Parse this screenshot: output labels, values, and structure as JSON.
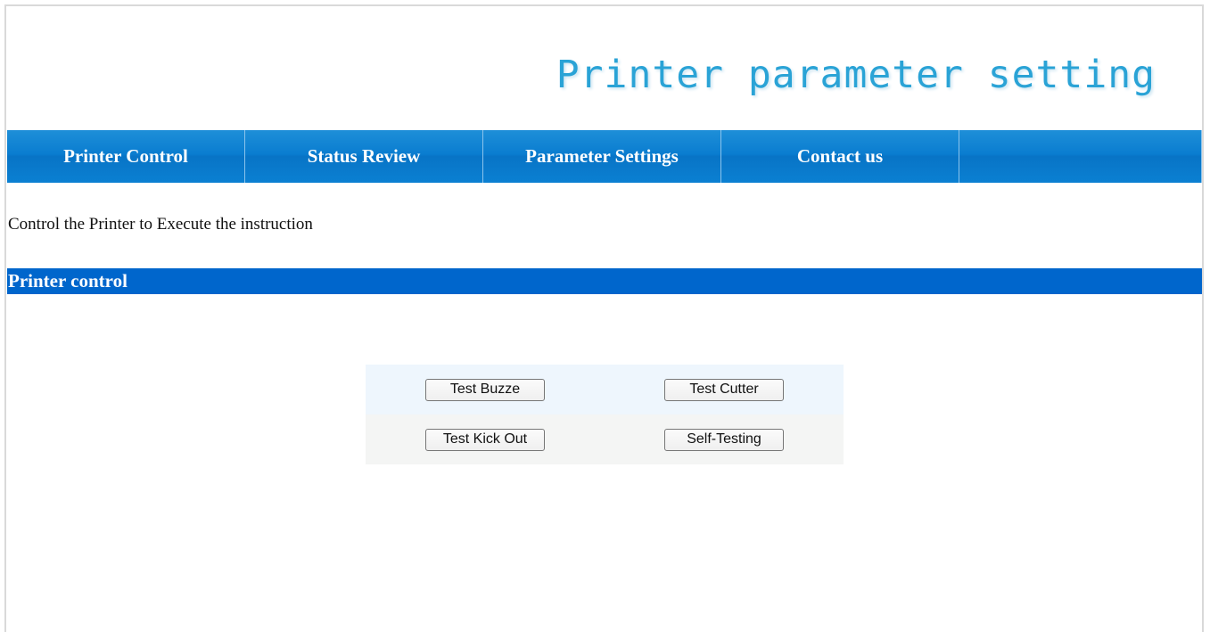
{
  "header": {
    "title": "Printer parameter setting"
  },
  "nav": {
    "items": [
      {
        "label": "Printer Control"
      },
      {
        "label": "Status Review"
      },
      {
        "label": "Parameter Settings"
      },
      {
        "label": "Contact us"
      },
      {
        "label": ""
      }
    ]
  },
  "main": {
    "description": "Control the Printer to Execute the instruction",
    "section_title": "Printer control",
    "buttons": {
      "test_buzzer": "Test Buzze",
      "test_cutter": "Test Cutter",
      "test_kick_out": "Test Kick Out",
      "self_testing": "Self-Testing"
    }
  },
  "colors": {
    "nav_blue": "#0a7dd0",
    "section_blue": "#0066cc",
    "title_cyan": "#2aa3d6"
  }
}
